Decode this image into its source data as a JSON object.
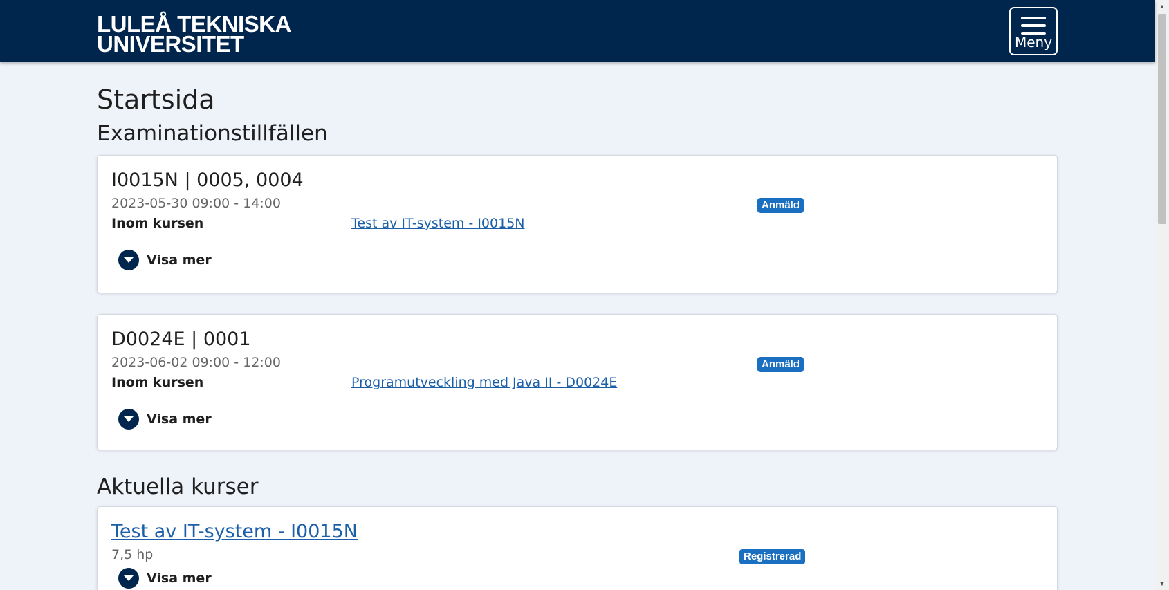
{
  "header": {
    "logo_line1": "LULEÅ TEKNISKA",
    "logo_line2": "UNIVERSITET",
    "menu_label": "Meny",
    "background_color": "#00264d"
  },
  "page": {
    "title": "Startsida"
  },
  "exams": {
    "heading": "Examinationstillfällen",
    "items": [
      {
        "title": "I0015N | 0005, 0004",
        "datetime": "2023-05-30 09:00 - 14:00",
        "course_label": "Inom kursen",
        "course_link": "Test av IT-system - I0015N",
        "status": "Anmäld",
        "expand_label": "Visa mer"
      },
      {
        "title": "D0024E | 0001",
        "datetime": "2023-06-02 09:00 - 12:00",
        "course_label": "Inom kursen",
        "course_link": "Programutveckling med Java II - D0024E",
        "status": "Anmäld",
        "expand_label": "Visa mer"
      }
    ]
  },
  "courses": {
    "heading": "Aktuella kurser",
    "items": [
      {
        "title": "Test av IT-system - I0015N",
        "credits": "7,5 hp",
        "status": "Registrerad",
        "expand_label": "Visa mer"
      }
    ]
  },
  "colors": {
    "badge": "#1b6fc0",
    "link": "#1b5fa8",
    "page_background": "#eef2f9"
  },
  "icons": {
    "menu": "hamburger-icon",
    "expand": "chevron-down-circle-icon"
  }
}
